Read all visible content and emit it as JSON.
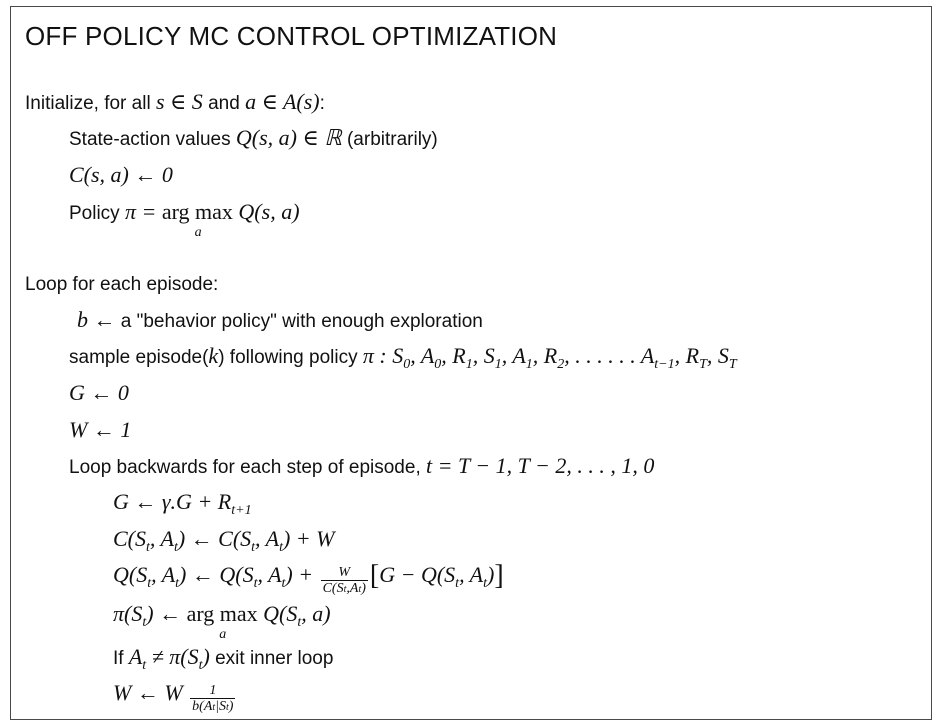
{
  "title": "OFF POLICY MC CONTROL OPTIMIZATION",
  "init": {
    "text_a": "Initialize, for all ",
    "math_a": "s ∈ S",
    "text_b": " and ",
    "math_b": "a ∈ A(s)",
    "text_c": ":"
  },
  "state_action": {
    "text_a": "State-action values ",
    "math_a": "Q(s, a) ∈ ℝ",
    "text_b": " (arbitrarily)"
  },
  "c_init": {
    "math": "C(s, a) ← 0"
  },
  "policy": {
    "text_a": "Policy ",
    "math_a": "π = ",
    "argmax": "arg max",
    "argmax_under": "a",
    "math_b": " Q(s, a)"
  },
  "loop_episode": {
    "text": "Loop for each episode:"
  },
  "behavior": {
    "math": "b ←",
    "text": " a \"behavior policy\" with enough exploration"
  },
  "sample": {
    "text_a": "sample episode(",
    "math_k": "k",
    "text_b": ") following policy ",
    "math_a": "π : S",
    "seq": "S₀, A₀, R₁, S₁, A₁, R₂, . . . . . . A",
    "seq_sub": "t−1",
    "seq_tail": ", R",
    "seq_sub2": "T",
    "seq_end": ", S",
    "seq_sub3": "T"
  },
  "g_init": {
    "math": "G ← 0"
  },
  "w_init": {
    "math": "W ← 1"
  },
  "loop_back": {
    "text": "Loop backwards for each step of episode, ",
    "math": "t = T − 1, T − 2, . . . , 1, 0"
  },
  "g_update": {
    "math_a": "G ← γ.G + R",
    "sub": "t+1"
  },
  "c_update": {
    "math": "C(S",
    "sub": "t"
  },
  "q_update": {
    "frac_num": "W"
  },
  "pi_update": {
    "argmax": "arg max",
    "argmax_under": "a"
  },
  "if_line": {
    "text_a": "If ",
    "text_b": " exit inner loop"
  },
  "w_update": {
    "frac_num": "1"
  }
}
